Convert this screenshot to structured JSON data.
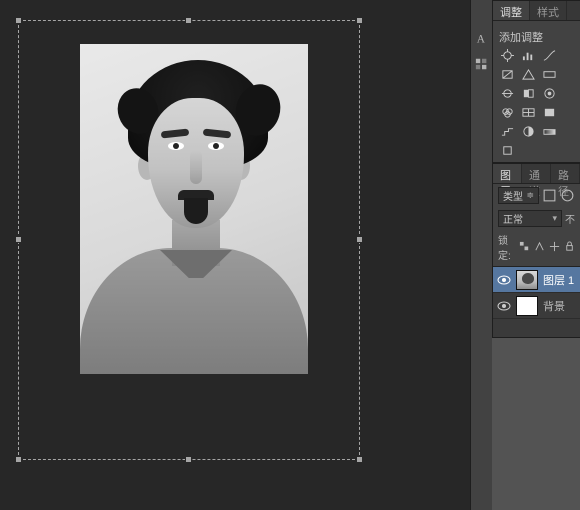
{
  "dock": {
    "icons": [
      "character-icon",
      "swatches-icon"
    ]
  },
  "adjustments": {
    "tab_label": "调整",
    "other_tab_label": "样式",
    "title": "添加调整",
    "icons": [
      "brightness-contrast-icon",
      "levels-icon",
      "curves-icon",
      "exposure-icon",
      "vibrance-icon",
      "hue-sat-icon",
      "color-balance-icon",
      "bw-icon",
      "photo-filter-icon",
      "channel-mixer-icon",
      "color-lookup-icon",
      "invert-icon",
      "posterize-icon",
      "threshold-icon",
      "gradient-map-icon",
      "selective-color-icon"
    ]
  },
  "layers": {
    "tabs": {
      "layers": "图层",
      "channels": "通道",
      "paths": "路径"
    },
    "kind_label": "类型",
    "blend_mode": "正常",
    "opacity_label": "不",
    "lock_label": "锁定:",
    "items": [
      {
        "name": "图层 1",
        "selected": true,
        "thumb": "portrait"
      },
      {
        "name": "背景",
        "selected": false,
        "thumb": "bg"
      }
    ]
  }
}
